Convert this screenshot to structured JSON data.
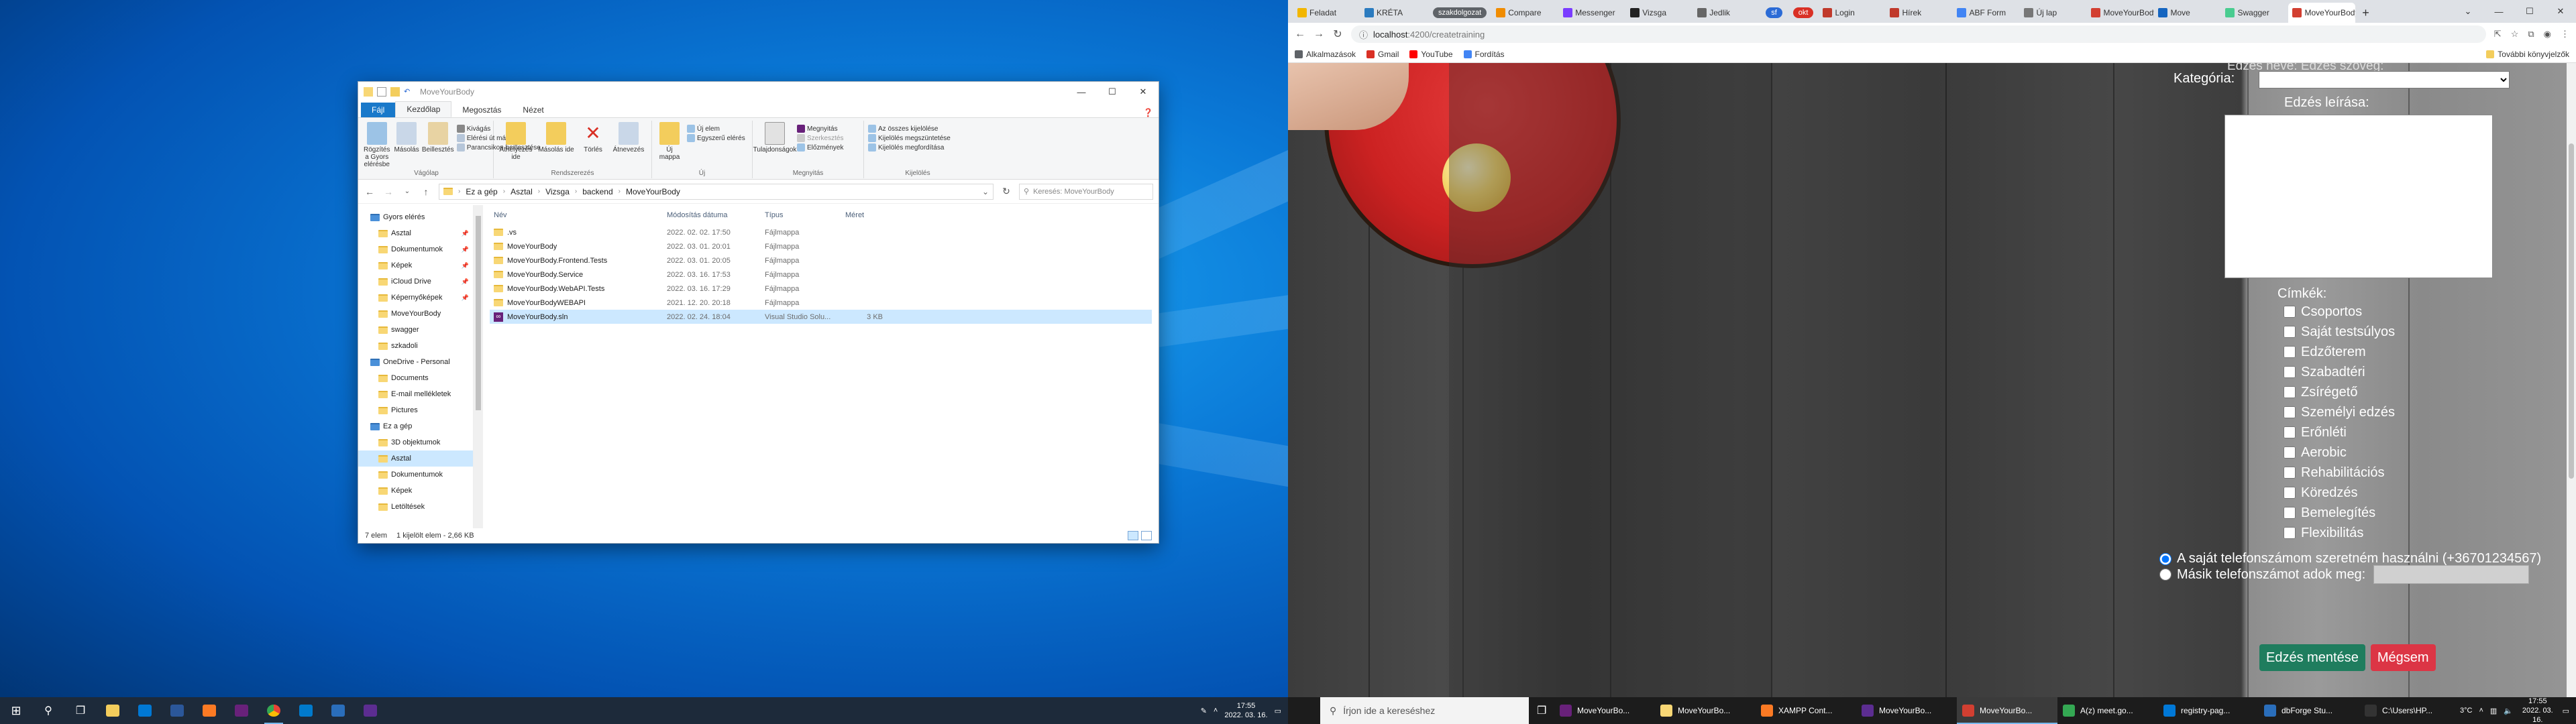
{
  "explorer": {
    "title": "MoveYourBody",
    "tabs": [
      "Fájl",
      "Kezdőlap",
      "Megosztás",
      "Nézet"
    ],
    "ribbon": {
      "clipboard": {
        "pin": "Rögzítés a Gyors elérésbe",
        "copy": "Másolás",
        "paste": "Beillesztés",
        "cut": "Kivágás",
        "copy_path": "Elérési út másolása",
        "paste_shortcut": "Parancsikon beillesztése",
        "group": "Vágólap"
      },
      "organize": {
        "move": "Áthelyezés ide",
        "copy_to": "Másolás ide",
        "delete": "Törlés",
        "rename": "Átnevezés",
        "group": "Rendszerezés"
      },
      "new": {
        "new_folder": "Új mappa",
        "new_item": "Új elem",
        "easy_access": "Egyszerű elérés",
        "group": "Új"
      },
      "open": {
        "properties": "Tulajdonságok",
        "open": "Megnyitás",
        "edit": "Szerkesztés",
        "history": "Előzmények",
        "group": "Megnyitás"
      },
      "select": {
        "select_all": "Az összes kijelölése",
        "select_none": "Kijelölés megszüntetése",
        "invert": "Kijelölés megfordítása",
        "group": "Kijelölés"
      }
    },
    "breadcrumb": [
      "Ez a gép",
      "Asztal",
      "Vizsga",
      "backend",
      "MoveYourBody"
    ],
    "search_placeholder": "Keresés: MoveYourBody",
    "nav": [
      {
        "label": "Gyors elérés",
        "sub": false,
        "sel": false
      },
      {
        "label": "Asztal",
        "sub": true,
        "sel": false,
        "pin": true
      },
      {
        "label": "Dokumentumok",
        "sub": true,
        "sel": false,
        "pin": true
      },
      {
        "label": "Képek",
        "sub": true,
        "sel": false,
        "pin": true
      },
      {
        "label": "iCloud Drive",
        "sub": true,
        "sel": false,
        "pin": true
      },
      {
        "label": "Képernyőképek",
        "sub": true,
        "sel": false,
        "pin": true
      },
      {
        "label": "MoveYourBody",
        "sub": true,
        "sel": false
      },
      {
        "label": "swagger",
        "sub": true,
        "sel": false
      },
      {
        "label": "szkadoli",
        "sub": true,
        "sel": false
      },
      {
        "label": "OneDrive - Personal",
        "sub": false,
        "sel": false
      },
      {
        "label": "Documents",
        "sub": true,
        "sel": false
      },
      {
        "label": "E-mail mellékletek",
        "sub": true,
        "sel": false
      },
      {
        "label": "Pictures",
        "sub": true,
        "sel": false
      },
      {
        "label": "Ez a gép",
        "sub": false,
        "sel": false
      },
      {
        "label": "3D objektumok",
        "sub": true,
        "sel": false
      },
      {
        "label": "Asztal",
        "sub": true,
        "sel": true
      },
      {
        "label": "Dokumentumok",
        "sub": true,
        "sel": false
      },
      {
        "label": "Képek",
        "sub": true,
        "sel": false
      },
      {
        "label": "Letöltések",
        "sub": true,
        "sel": false
      }
    ],
    "columns": {
      "name": "Név",
      "date": "Módosítás dátuma",
      "type": "Típus",
      "size": "Méret"
    },
    "files": [
      {
        "name": ".vs",
        "date": "2022. 02. 02. 17:50",
        "type": "Fájlmappa",
        "size": "",
        "kind": "folder",
        "sel": false
      },
      {
        "name": "MoveYourBody",
        "date": "2022. 03. 01. 20:01",
        "type": "Fájlmappa",
        "size": "",
        "kind": "folder",
        "sel": false
      },
      {
        "name": "MoveYourBody.Frontend.Tests",
        "date": "2022. 03. 01. 20:05",
        "type": "Fájlmappa",
        "size": "",
        "kind": "folder",
        "sel": false
      },
      {
        "name": "MoveYourBody.Service",
        "date": "2022. 03. 16. 17:53",
        "type": "Fájlmappa",
        "size": "",
        "kind": "folder",
        "sel": false
      },
      {
        "name": "MoveYourBody.WebAPI.Tests",
        "date": "2022. 03. 16. 17:29",
        "type": "Fájlmappa",
        "size": "",
        "kind": "folder",
        "sel": false
      },
      {
        "name": "MoveYourBodyWEBAPI",
        "date": "2021. 12. 20. 20:18",
        "type": "Fájlmappa",
        "size": "",
        "kind": "folder",
        "sel": false
      },
      {
        "name": "MoveYourBody.sln",
        "date": "2022. 02. 24. 18:04",
        "type": "Visual Studio Solu...",
        "size": "3 KB",
        "kind": "sln",
        "sel": true
      }
    ],
    "status": {
      "count": "7 elem",
      "selected": "1 kijelölt elem - 2,66 KB"
    }
  },
  "taskbar_left": {
    "time": "17:55",
    "date": "2022. 03. 16."
  },
  "chrome": {
    "tabs": [
      {
        "label": "Feladat",
        "color": "#f2b600"
      },
      {
        "label": "KRÉTA",
        "color": "#2b7bbf"
      },
      {
        "label": "szakdolgozat",
        "color": "#5f6368",
        "group": true
      },
      {
        "label": "Compare",
        "color": "#f08c00"
      },
      {
        "label": "Messenger",
        "color": "#7a3cff"
      },
      {
        "label": "Vizsga",
        "color": "#222"
      },
      {
        "label": "Jedlik",
        "color": "#666"
      },
      {
        "label": "sf",
        "color": "#2b6bd6",
        "pill": true
      },
      {
        "label": "okt",
        "color": "#d93025",
        "pill": true
      },
      {
        "label": "Login",
        "color": "#c0392b"
      },
      {
        "label": "Hírek",
        "color": "#c0392b"
      },
      {
        "label": "ABF Form",
        "color": "#4285f4"
      },
      {
        "label": "Új lap",
        "color": "#777"
      },
      {
        "label": "MoveYourBody",
        "color": "#d23f31"
      },
      {
        "label": "Move",
        "color": "#1565c0"
      },
      {
        "label": "Swagger",
        "color": "#49cc90"
      },
      {
        "label": "MoveYourBody",
        "color": "#d23f31",
        "active": true
      }
    ],
    "url_host": "localhost",
    "url_path": ":4200/createtraining",
    "bookmarks": [
      {
        "label": "Alkalmazások",
        "color": "#5f6368"
      },
      {
        "label": "Gmail",
        "color": "#d93025"
      },
      {
        "label": "YouTube",
        "color": "#ff0000"
      },
      {
        "label": "Fordítás",
        "color": "#4285f4"
      }
    ],
    "other_bookmarks": "További könyvjelzők"
  },
  "form": {
    "top_cut": "Edzés neve: Edzés szöveg:",
    "category_label": "Kategória:",
    "description_label": "Edzés leírása:",
    "tags_label": "Címkék:",
    "tags": [
      "Csoportos",
      "Saját testsúlyos",
      "Edzőterem",
      "Szabadtéri",
      "Zsírégető",
      "Személyi edzés",
      "Erőnléti",
      "Aerobic",
      "Rehabilitációs",
      "Köredzés",
      "Bemelegítés",
      "Flexibilitás"
    ],
    "phone_own": "A saját telefonszámom szeretném használni (+36701234567)",
    "phone_other": "Másik telefonszámot adok meg:",
    "save_button": "Edzés mentése",
    "cancel_button": "Mégsem"
  },
  "taskbar_right": {
    "search_placeholder": "Írjon ide a kereséshez",
    "apps": [
      {
        "label": "MoveYourBo...",
        "color": "#68217a"
      },
      {
        "label": "MoveYourBo...",
        "color": "#f8d775"
      },
      {
        "label": "XAMPP Cont...",
        "color": "#fb7a24"
      },
      {
        "label": "MoveYourBo...",
        "color": "#5c2d91"
      },
      {
        "label": "MoveYourBo...",
        "color": "#d23f31",
        "active": true
      },
      {
        "label": "A(z) meet.go...",
        "color": "#34a853"
      },
      {
        "label": "registry-pag...",
        "color": "#0078d7"
      },
      {
        "label": "dbForge Stu...",
        "color": "#2a6ebb"
      },
      {
        "label": "C:\\Users\\HP...",
        "color": "#333"
      }
    ],
    "temp": "3°C",
    "time": "17:55",
    "date": "2022. 03. 16."
  }
}
